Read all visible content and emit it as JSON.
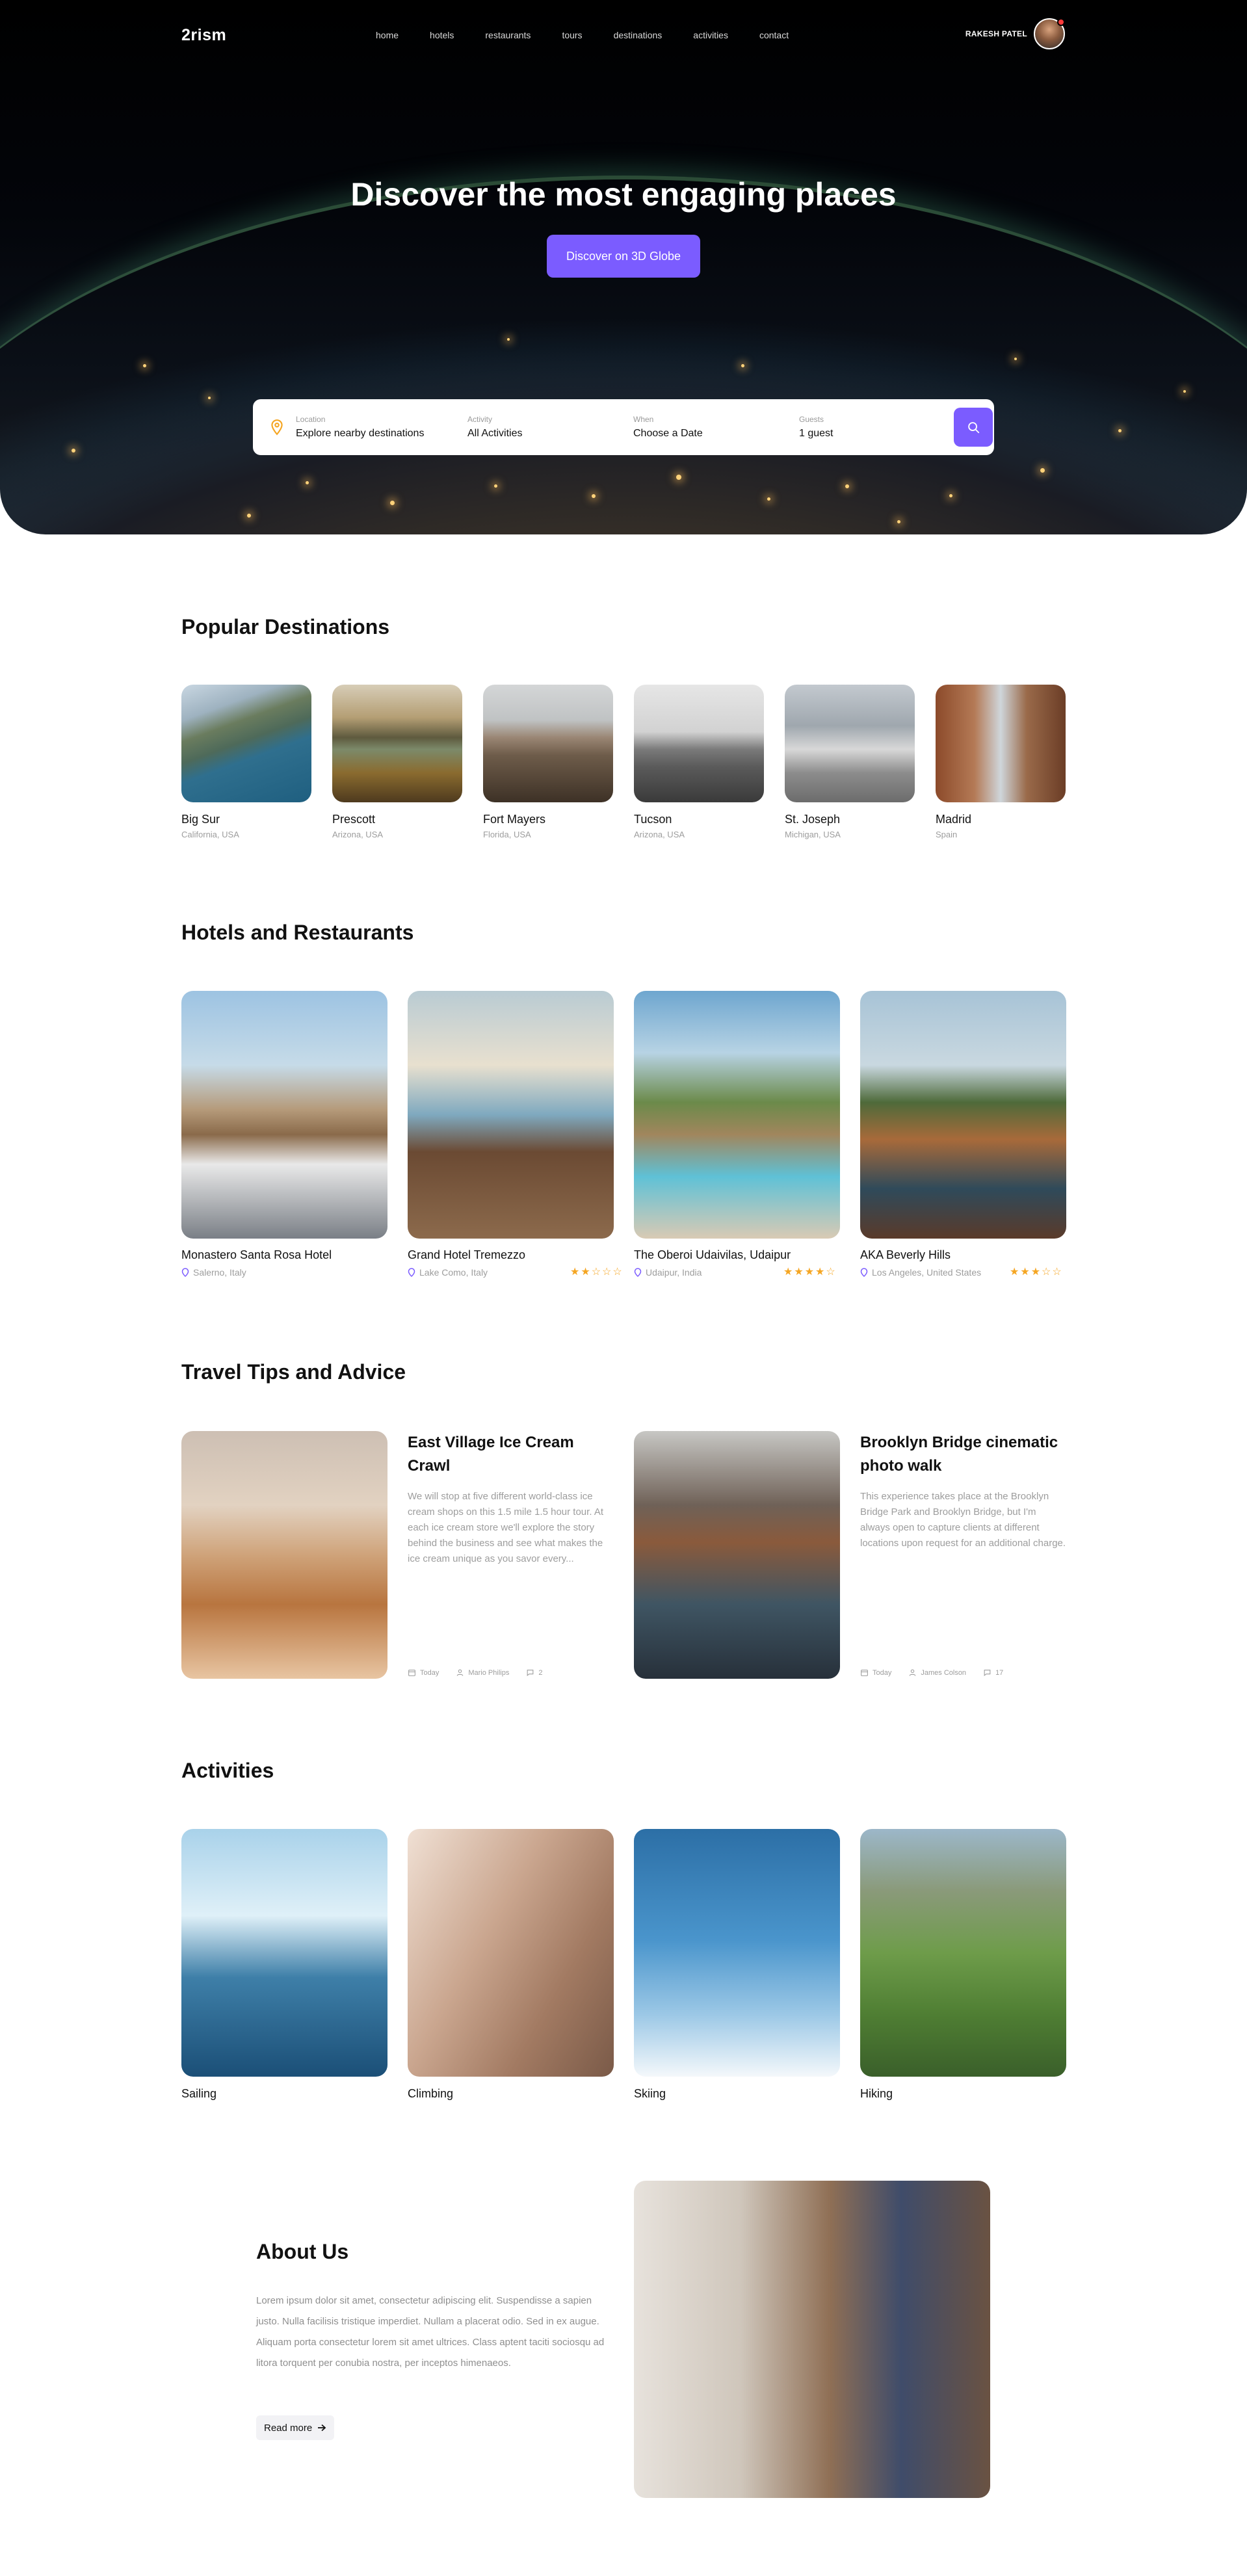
{
  "nav": {
    "logo": "2rism",
    "menu": [
      "home",
      "hotels",
      "restaurants",
      "tours",
      "destinations",
      "activities",
      "contact"
    ],
    "user_name": "RAKESH PATEL"
  },
  "hero": {
    "title": "Discover the most engaging places",
    "button": "Discover on 3D Globe"
  },
  "search": {
    "fields": [
      {
        "label": "Location",
        "value": "Explore nearby destinations"
      },
      {
        "label": "Activity",
        "value": "All Activities"
      },
      {
        "label": "When",
        "value": "Choose a Date"
      },
      {
        "label": "Guests",
        "value": "1 guest"
      }
    ]
  },
  "destinations": {
    "title": "Popular Destinations",
    "items": [
      {
        "name": "Big Sur",
        "location": "California, USA"
      },
      {
        "name": "Prescott",
        "location": "Arizona, USA"
      },
      {
        "name": "Fort Mayers",
        "location": "Florida, USA"
      },
      {
        "name": "Tucson",
        "location": "Arizona, USA"
      },
      {
        "name": "St. Joseph",
        "location": "Michigan, USA"
      },
      {
        "name": "Madrid",
        "location": "Spain"
      }
    ]
  },
  "hotels": {
    "title": "Hotels and Restaurants",
    "items": [
      {
        "name": "Monastero Santa Rosa Hotel",
        "location": "Salerno, Italy",
        "rating": 0
      },
      {
        "name": "Grand Hotel Tremezzo",
        "location": "Lake Como, Italy",
        "rating": 2
      },
      {
        "name": "The Oberoi Udaivilas, Udaipur",
        "location": "Udaipur, India",
        "rating": 4
      },
      {
        "name": "AKA Beverly Hills",
        "location": "Los Angeles, United States",
        "rating": 3
      }
    ],
    "colors": {
      "star_on": "#f5a623",
      "star_off": "#f5a623",
      "pin": "#7b5cff"
    }
  },
  "tips": {
    "title": "Travel Tips and Advice",
    "items": [
      {
        "title": "East Village Ice Cream Crawl",
        "text": "We will stop at five different world-class ice cream shops on this 1.5 mile 1.5 hour tour. At each ice cream store we'll explore the story behind the business and see what makes the ice cream unique as you savor every...",
        "date": "Today",
        "author": "Mario Philips",
        "comments": "2"
      },
      {
        "title": "Brooklyn Bridge cinematic photo walk",
        "text": "This experience takes place at the Brooklyn Bridge Park and Brooklyn Bridge, but I'm always open to capture clients at different locations upon request for an additional charge.",
        "date": "Today",
        "author": "James Colson",
        "comments": "17"
      }
    ]
  },
  "activities": {
    "title": "Activities",
    "items": [
      "Sailing",
      "Climbing",
      "Skiing",
      "Hiking"
    ]
  },
  "about": {
    "title": "About Us",
    "text": "Lorem ipsum dolor sit amet, consectetur adipiscing elit. Suspendisse a sapien justo. Nulla facilisis tristique imperdiet. Nullam a placerat odio. Sed in ex augue. Aliquam porta consectetur lorem sit amet ultrices. Class aptent taciti sociosqu ad litora torquent per conubia nostra, per inceptos himenaeos.",
    "button": "Read more"
  },
  "colors": {
    "accent": "#7b5cff",
    "location_pin": "#f5a623"
  }
}
